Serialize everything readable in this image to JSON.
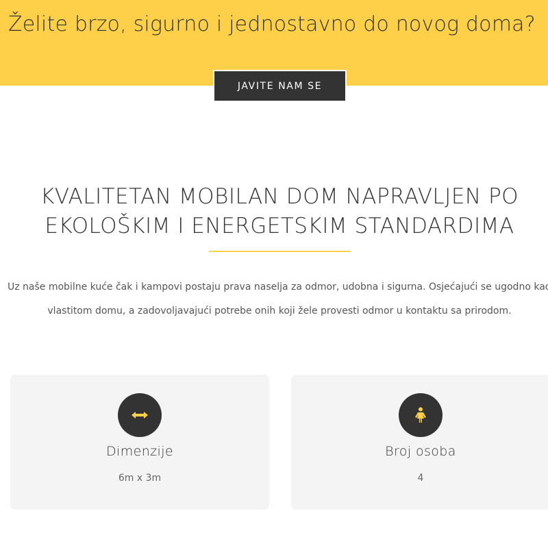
{
  "banner": {
    "title": "Želite brzo, sigurno i jednostavno do novog doma?",
    "cta_label": "JAVITE NAM SE",
    "background_color": "#fecf48"
  },
  "section": {
    "heading_line1": "KVALITETAN MOBILAN DOM NAPRAVLJEN PO",
    "heading_line2": "EKOLOŠKIM I ENERGETSKIM STANDARDIMA",
    "intro_line1": "Uz naše mobilne kuće čak i kampovi postaju prava naselja za odmor, udobna i sigurna. Osjećajući se ugodno kao u",
    "intro_line2": "vlastitom domu, a zadovoljavajući potrebe onih koji žele provesti odmor u kontaktu sa prirodom."
  },
  "features": [
    {
      "icon": "arrows-horizontal-icon",
      "title": "Dimenzije",
      "value": "6m x 3m"
    },
    {
      "icon": "person-icon",
      "title": "Broj osoba",
      "value": "4"
    }
  ],
  "colors": {
    "accent": "#fecf48",
    "dark": "#333333",
    "card_bg": "#f4f4f4"
  }
}
